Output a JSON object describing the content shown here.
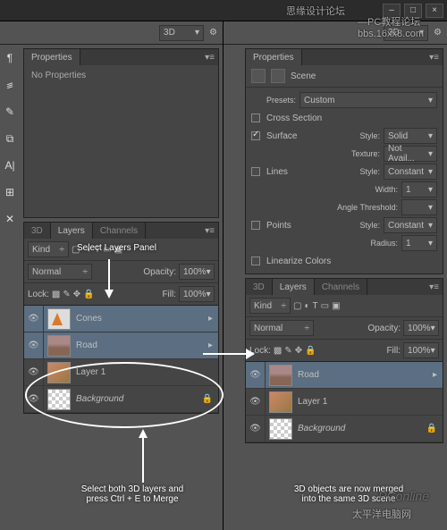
{
  "watermarks": {
    "w1": "思缘设计论坛",
    "w2": "—PС教程论坛\nbbs.16xx8.com",
    "w3": "太平洋电脑网",
    "w4": "PConline"
  },
  "win": {
    "min": "‒",
    "max": "□",
    "close": "×"
  },
  "toolbar": {
    "mode": "3D",
    "chev": "▾"
  },
  "left": {
    "prop": {
      "tab": "Properties",
      "menu": "▾≡",
      "noprop": "No Properties"
    },
    "tabs": {
      "t1": "3D",
      "t2": "Layers",
      "t3": "Channels"
    },
    "kind": {
      "label": "Kind",
      "t": "T",
      "chev": "÷"
    },
    "blend": "Normal",
    "opacity_l": "Opacity:",
    "opacity_v": "100%",
    "fill_l": "Fill:",
    "fill_v": "100%",
    "lock_l": "Lock:",
    "layers": [
      "Cones",
      "Road",
      "Layer 1",
      "Background"
    ]
  },
  "right": {
    "prop": {
      "tab": "Properties",
      "scene": "Scene",
      "presets_l": "Presets:",
      "presets_v": "Custom",
      "cross": "Cross Section",
      "surface": "Surface",
      "lines": "Lines",
      "points": "Points",
      "linearize": "Linearize Colors",
      "style_l": "Style:",
      "solid": "Solid",
      "texture_l": "Texture:",
      "texture_v": "Not Avail...",
      "constant": "Constant",
      "width_l": "Width:",
      "width_v": "1",
      "angle_l": "Angle Threshold:",
      "radius_l": "Radius:",
      "radius_v": "1"
    },
    "tabs": {
      "t1": "3D",
      "t2": "Layers",
      "t3": "Channels"
    },
    "kind": {
      "label": "Kind",
      "t": "T",
      "chev": "÷"
    },
    "blend": "Normal",
    "opacity_l": "Opacity:",
    "opacity_v": "100%",
    "fill_l": "Fill:",
    "fill_v": "100%",
    "lock_l": "Lock:",
    "layers": [
      "Road",
      "Layer 1",
      "Background"
    ]
  },
  "ann": {
    "a1": "Select Layers Panel",
    "a2": "Select both 3D layers and press Ctrl + E to Merge",
    "a3": "3D objects are now merged into the same 3D scene"
  }
}
